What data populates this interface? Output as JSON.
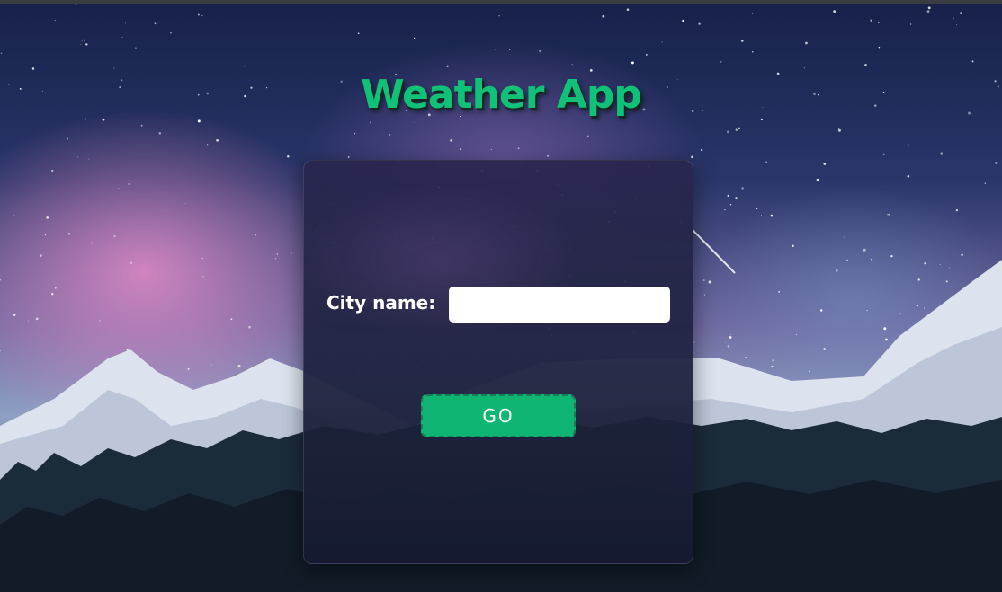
{
  "app": {
    "title": "Weather App"
  },
  "form": {
    "city_label": "City name:",
    "city_value": "",
    "go_label": "GO"
  },
  "colors": {
    "accent": "#0fb572",
    "title": "#10c277"
  }
}
